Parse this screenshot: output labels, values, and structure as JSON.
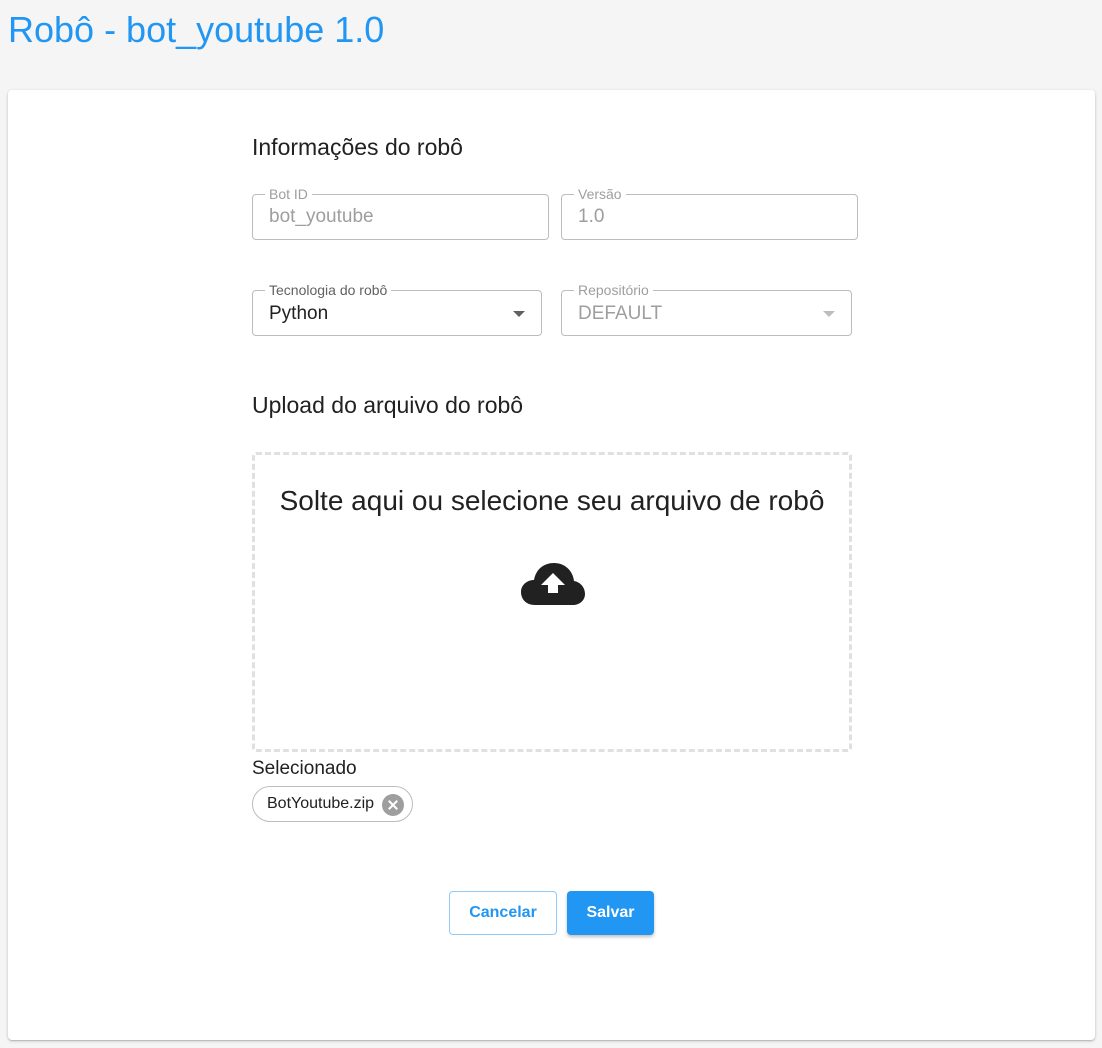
{
  "page": {
    "title": "Robô - bot_youtube 1.0"
  },
  "sections": {
    "info_title": "Informações do robô",
    "upload_title": "Upload do arquivo do robô"
  },
  "fields": {
    "bot_id": {
      "label": "Bot ID",
      "value": "bot_youtube"
    },
    "versao": {
      "label": "Versão",
      "value": "1.0"
    },
    "tecnologia": {
      "label": "Tecnologia do robô",
      "value": "Python"
    },
    "repositorio": {
      "label": "Repositório",
      "value": "DEFAULT"
    }
  },
  "upload": {
    "dropzone_text": "Solte aqui ou selecione seu arquivo de robô",
    "icon": "cloud-upload-icon",
    "selected_label": "Selecionado",
    "selected_file": "BotYoutube.zip"
  },
  "actions": {
    "cancel_label": "Cancelar",
    "save_label": "Salvar"
  },
  "colors": {
    "accent": "#2196f3",
    "background": "#f5f5f5",
    "card": "#ffffff"
  }
}
